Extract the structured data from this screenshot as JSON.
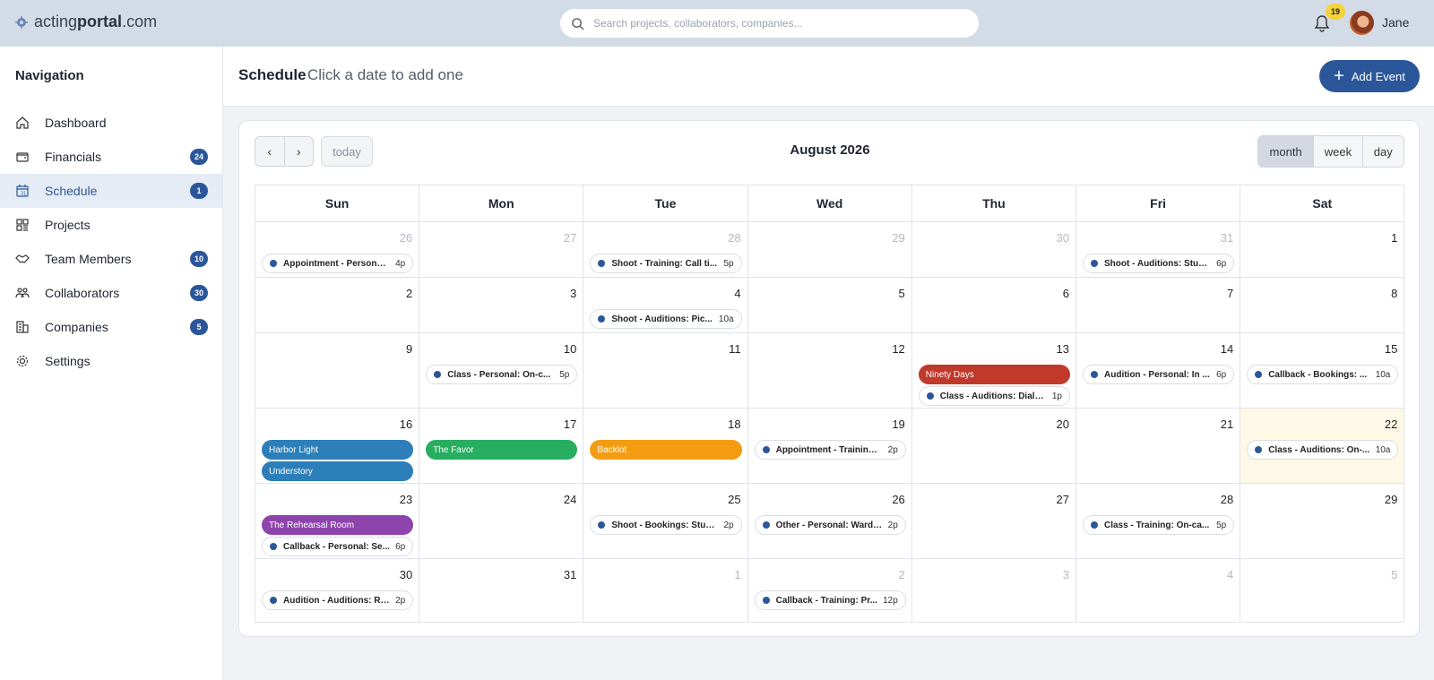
{
  "app": {
    "logo_light": "acting",
    "logo_bold": "portal",
    "logo_suffix": ".com"
  },
  "search": {
    "placeholder": "Search projects, collaborators, companies..."
  },
  "user": {
    "notification_count": "19",
    "name": "Jane"
  },
  "sidebar": {
    "title": "Navigation",
    "items": [
      {
        "label": "Dashboard",
        "icon": "home-icon",
        "count": ""
      },
      {
        "label": "Financials",
        "icon": "wallet-icon",
        "count": "24"
      },
      {
        "label": "Schedule",
        "icon": "calendar-icon",
        "count": "1"
      },
      {
        "label": "Projects",
        "icon": "grid-icon",
        "count": ""
      },
      {
        "label": "Team Members",
        "icon": "handshake-icon",
        "count": "10"
      },
      {
        "label": "Collaborators",
        "icon": "people-icon",
        "count": "30"
      },
      {
        "label": "Companies",
        "icon": "building-icon",
        "count": "5"
      },
      {
        "label": "Settings",
        "icon": "gear-icon",
        "count": ""
      }
    ]
  },
  "header": {
    "title": "Schedule",
    "subtitle": "Click a date to add one",
    "add_label": "Add Event"
  },
  "calendar": {
    "title": "August 2026",
    "today_label": "today",
    "views": [
      "month",
      "week",
      "day"
    ],
    "active_view": "month",
    "weekdays": [
      "Sun",
      "Mon",
      "Tue",
      "Wed",
      "Thu",
      "Fri",
      "Sat"
    ],
    "weeks": [
      [
        {
          "day": "26",
          "muted": true,
          "events": [
            {
              "kind": "pill",
              "title": "Appointment - Personal...",
              "time": "4p"
            }
          ]
        },
        {
          "day": "27",
          "muted": true,
          "events": []
        },
        {
          "day": "28",
          "muted": true,
          "events": [
            {
              "kind": "pill",
              "title": "Shoot - Training: Call ti...",
              "time": "5p"
            }
          ]
        },
        {
          "day": "29",
          "muted": true,
          "events": []
        },
        {
          "day": "30",
          "muted": true,
          "events": []
        },
        {
          "day": "31",
          "muted": true,
          "events": [
            {
              "kind": "pill",
              "title": "Shoot - Auditions: Stud...",
              "time": "6p"
            }
          ]
        },
        {
          "day": "1",
          "muted": false,
          "events": []
        }
      ],
      [
        {
          "day": "2",
          "muted": false,
          "events": []
        },
        {
          "day": "3",
          "muted": false,
          "events": []
        },
        {
          "day": "4",
          "muted": false,
          "events": [
            {
              "kind": "pill",
              "title": "Shoot - Auditions: Pic...",
              "time": "10a"
            }
          ]
        },
        {
          "day": "5",
          "muted": false,
          "events": []
        },
        {
          "day": "6",
          "muted": false,
          "events": []
        },
        {
          "day": "7",
          "muted": false,
          "events": []
        },
        {
          "day": "8",
          "muted": false,
          "events": []
        }
      ],
      [
        {
          "day": "9",
          "muted": false,
          "events": []
        },
        {
          "day": "10",
          "muted": false,
          "events": [
            {
              "kind": "pill",
              "title": "Class - Personal: On-c...",
              "time": "5p"
            }
          ]
        },
        {
          "day": "11",
          "muted": false,
          "events": []
        },
        {
          "day": "12",
          "muted": false,
          "events": []
        },
        {
          "day": "13",
          "muted": false,
          "events": [
            {
              "kind": "bar",
              "title": "Ninety Days",
              "color": "#c0392b"
            },
            {
              "kind": "pill",
              "title": "Class - Auditions: Diale...",
              "time": "1p"
            }
          ]
        },
        {
          "day": "14",
          "muted": false,
          "events": [
            {
              "kind": "pill",
              "title": "Audition - Personal: In ...",
              "time": "6p"
            }
          ]
        },
        {
          "day": "15",
          "muted": false,
          "events": [
            {
              "kind": "pill",
              "title": "Callback - Bookings: ...",
              "time": "10a"
            }
          ]
        }
      ],
      [
        {
          "day": "16",
          "muted": false,
          "events": [
            {
              "kind": "bar",
              "title": "Harbor Light",
              "color": "#2c7fb8"
            },
            {
              "kind": "bar",
              "title": "Understory",
              "color": "#2c7fb8"
            }
          ]
        },
        {
          "day": "17",
          "muted": false,
          "events": [
            {
              "kind": "bar",
              "title": "The Favor",
              "color": "#27ae60"
            }
          ]
        },
        {
          "day": "18",
          "muted": false,
          "events": [
            {
              "kind": "bar",
              "title": "Backlot",
              "color": "#f39c12"
            }
          ]
        },
        {
          "day": "19",
          "muted": false,
          "events": [
            {
              "kind": "pill",
              "title": "Appointment - Training:...",
              "time": "2p"
            }
          ]
        },
        {
          "day": "20",
          "muted": false,
          "events": []
        },
        {
          "day": "21",
          "muted": false,
          "events": []
        },
        {
          "day": "22",
          "muted": false,
          "today": true,
          "events": [
            {
              "kind": "pill",
              "title": "Class - Auditions: On-...",
              "time": "10a"
            }
          ]
        }
      ],
      [
        {
          "day": "23",
          "muted": false,
          "events": [
            {
              "kind": "bar",
              "title": "The Rehearsal Room",
              "color": "#8e44ad"
            },
            {
              "kind": "pill",
              "title": "Callback - Personal: Se...",
              "time": "6p"
            }
          ]
        },
        {
          "day": "24",
          "muted": false,
          "events": []
        },
        {
          "day": "25",
          "muted": false,
          "events": [
            {
              "kind": "pill",
              "title": "Shoot - Bookings: Stud...",
              "time": "2p"
            }
          ]
        },
        {
          "day": "26",
          "muted": false,
          "events": [
            {
              "kind": "pill",
              "title": "Other - Personal: Wardr...",
              "time": "2p"
            }
          ]
        },
        {
          "day": "27",
          "muted": false,
          "events": []
        },
        {
          "day": "28",
          "muted": false,
          "events": [
            {
              "kind": "pill",
              "title": "Class - Training: On-ca...",
              "time": "5p"
            }
          ]
        },
        {
          "day": "29",
          "muted": false,
          "events": []
        }
      ],
      [
        {
          "day": "30",
          "muted": false,
          "events": [
            {
              "kind": "pill",
              "title": "Audition - Auditions: Re...",
              "time": "2p"
            }
          ]
        },
        {
          "day": "31",
          "muted": false,
          "events": []
        },
        {
          "day": "1",
          "muted": true,
          "events": []
        },
        {
          "day": "2",
          "muted": true,
          "events": [
            {
              "kind": "pill",
              "title": "Callback - Training: Pr...",
              "time": "12p"
            }
          ]
        },
        {
          "day": "3",
          "muted": true,
          "events": []
        },
        {
          "day": "4",
          "muted": true,
          "events": []
        },
        {
          "day": "5",
          "muted": true,
          "events": []
        }
      ]
    ]
  }
}
